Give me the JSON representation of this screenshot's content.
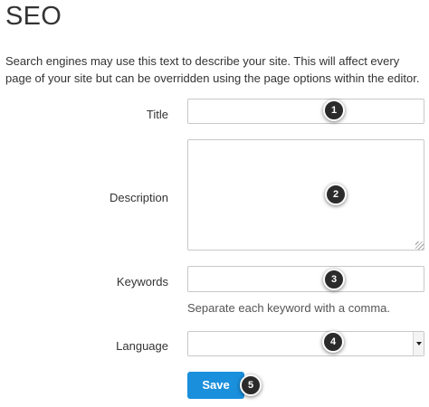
{
  "section": {
    "title": "SEO",
    "description": "Search engines may use this text to describe your site. This will affect every page of your site but can be overridden using the page options within the editor."
  },
  "form": {
    "title_label": "Title",
    "title_value": "",
    "description_label": "Description",
    "description_value": "",
    "keywords_label": "Keywords",
    "keywords_value": "",
    "keywords_help": "Separate each keyword with a comma.",
    "language_label": "Language",
    "language_selected": "",
    "save_label": "Save"
  },
  "callouts": [
    "1",
    "2",
    "3",
    "4",
    "5"
  ]
}
